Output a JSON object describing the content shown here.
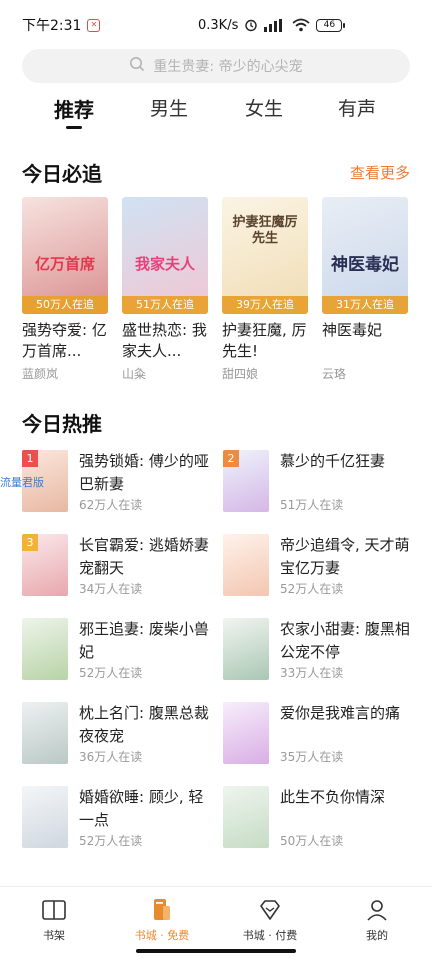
{
  "status_bar": {
    "time": "下午2:31",
    "speed": "0.3K/s",
    "battery": "46"
  },
  "search": {
    "placeholder": "重生贵妻: 帝少的心尖宠"
  },
  "tabs": [
    {
      "label": "推荐",
      "active": true
    },
    {
      "label": "男生",
      "active": false
    },
    {
      "label": "女生",
      "active": false
    },
    {
      "label": "有声",
      "active": false
    }
  ],
  "must_read": {
    "title": "今日必追",
    "more": "查看更多",
    "books": [
      {
        "title": "强势夺爱: 亿万首席...",
        "author": "蓝颜岚",
        "readers": "50万人在追",
        "cover_text": "亿万首席",
        "cover_colors": [
          "#f6e3df",
          "#d98d8d"
        ],
        "text_color": "#e2384f"
      },
      {
        "title": "盛世热恋: 我家夫人...",
        "author": "山粂",
        "readers": "51万人在追",
        "cover_text": "我家夫人",
        "cover_colors": [
          "#cfe2f3",
          "#f2c6d2"
        ],
        "text_color": "#e8407a"
      },
      {
        "title": "护妻狂魔, 厉先生!",
        "author": "甜四娘",
        "readers": "39万人在追",
        "cover_text": "护妻狂魔厉先生",
        "cover_colors": [
          "#fbf4e4",
          "#f0dcb4"
        ],
        "text_color": "#5a4430"
      },
      {
        "title": "神医毒妃",
        "author": "云珞",
        "readers": "31万人在追",
        "cover_text": "神医毒妃",
        "cover_colors": [
          "#e9eef5",
          "#c9d6ea"
        ],
        "text_color": "#2a2f55"
      }
    ]
  },
  "hot": {
    "title": "今日热推",
    "items": [
      {
        "rank": "1",
        "title": "强势锁婚: 傅少的哑巴新妻",
        "readers": "62万人在读",
        "rank_color": "#ef4e4e",
        "cover_colors": [
          "#fbe7de",
          "#e8b8a2"
        ]
      },
      {
        "rank": "2",
        "title": "慕少的千亿狂妻",
        "readers": "51万人在读",
        "rank_color": "#f08a3c",
        "cover_colors": [
          "#eef3fb",
          "#d5b7e6"
        ]
      },
      {
        "rank": "3",
        "title": "长官霸爱: 逃婚娇妻宠翻天",
        "readers": "34万人在读",
        "rank_color": "#f2b23a",
        "cover_colors": [
          "#fbe9ea",
          "#e8a7ad"
        ]
      },
      {
        "rank": "",
        "title": "帝少追缉令, 天才萌宝亿万妻",
        "readers": "52万人在读",
        "rank_color": "",
        "cover_colors": [
          "#fff2ea",
          "#f3c6b1"
        ]
      },
      {
        "rank": "",
        "title": "邪王追妻: 废柴小兽妃",
        "readers": "52万人在读",
        "rank_color": "",
        "cover_colors": [
          "#eef4ea",
          "#b7d3a6"
        ]
      },
      {
        "rank": "",
        "title": "农家小甜妻: 腹黑相公宠不停",
        "readers": "33万人在读",
        "rank_color": "",
        "cover_colors": [
          "#f2f5f0",
          "#a9c7b4"
        ]
      },
      {
        "rank": "",
        "title": "枕上名门: 腹黑总裁夜夜宠",
        "readers": "36万人在读",
        "rank_color": "",
        "cover_colors": [
          "#eef0f2",
          "#b9c9c5"
        ]
      },
      {
        "rank": "",
        "title": "爱你是我难言的痛",
        "readers": "35万人在读",
        "rank_color": "",
        "cover_colors": [
          "#f7eefb",
          "#d9aee5"
        ]
      },
      {
        "rank": "",
        "title": "婚婚欲睡: 顾少, 轻一点",
        "readers": "52万人在读",
        "rank_color": "",
        "cover_colors": [
          "#f4f6f8",
          "#cfd7df"
        ]
      },
      {
        "rank": "",
        "title": "此生不负你情深",
        "readers": "50万人在读",
        "rank_color": "",
        "cover_colors": [
          "#eef5ee",
          "#c6dcc4"
        ]
      }
    ]
  },
  "floating_tag": "流量君版",
  "bottom_nav": [
    {
      "label": "书架",
      "icon": "book-open-icon",
      "active": false
    },
    {
      "label": "书城 · 免费",
      "icon": "bookstore-free-icon",
      "active": true
    },
    {
      "label": "书城 · 付费",
      "icon": "diamond-icon",
      "active": false
    },
    {
      "label": "我的",
      "icon": "user-icon",
      "active": false
    }
  ],
  "colors": {
    "accent": "#e88b2e",
    "more_link": "#ef7a3a",
    "badge": "#e8a028"
  }
}
